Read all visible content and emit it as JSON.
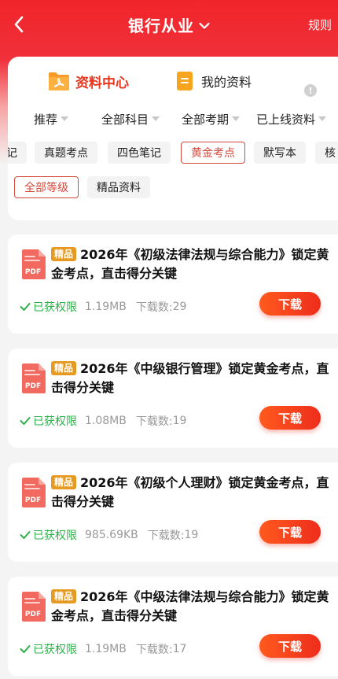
{
  "header": {
    "title": "银行从业",
    "rules": "规则"
  },
  "tabs": {
    "center": "资料中心",
    "mine": "我的资料"
  },
  "filters": [
    "推荐",
    "全部科目",
    "全部考期",
    "已上线资料"
  ],
  "chips": [
    "真题考点",
    "四色笔记",
    "黄金考点",
    "默写本",
    "核"
  ],
  "chip_partial_left": "记",
  "levels": [
    "全部等级",
    "精品资料"
  ],
  "colors": {
    "accent": "#e8361f",
    "badge": "#e69a22",
    "permission": "#2db04a"
  },
  "items": [
    {
      "badge": "精品",
      "title": "2026年《初级法律法规与综合能力》锁定黄金考点，直击得分关键",
      "permission": "已获权限",
      "size": "1.19MB",
      "downloads_label": "下载数:",
      "downloads": "29",
      "button": "下载"
    },
    {
      "badge": "精品",
      "title": "2026年《中级银行管理》锁定黄金考点，直击得分关键",
      "permission": "已获权限",
      "size": "1.08MB",
      "downloads_label": "下载数:",
      "downloads": "19",
      "button": "下载"
    },
    {
      "badge": "精品",
      "title": "2026年《初级个人理财》锁定黄金考点，直击得分关键",
      "permission": "已获权限",
      "size": "985.69KB",
      "downloads_label": "下载数:",
      "downloads": "19",
      "button": "下载"
    },
    {
      "badge": "精品",
      "title": "2026年《中级法律法规与综合能力》锁定黄金考点，直击得分关键",
      "permission": "已获权限",
      "size": "1.19MB",
      "downloads_label": "下载数:",
      "downloads": "17",
      "button": "下载"
    }
  ]
}
